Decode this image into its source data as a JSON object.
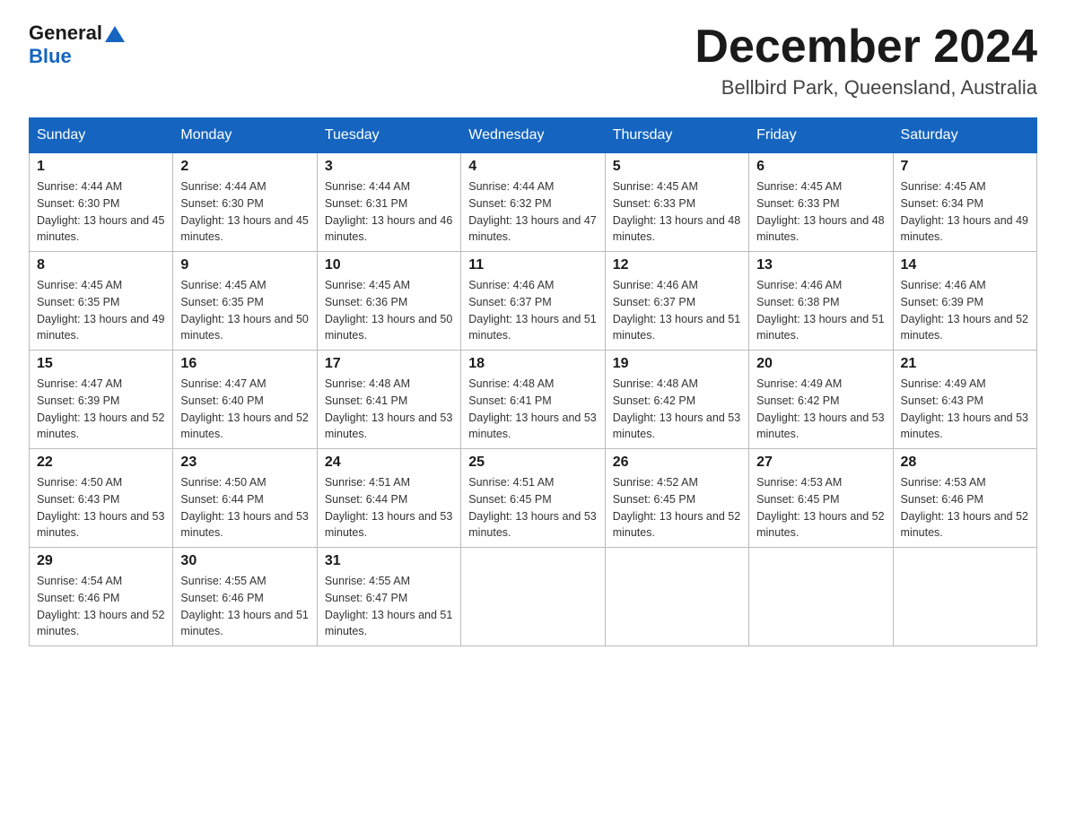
{
  "header": {
    "logo_general": "General",
    "logo_blue": "Blue",
    "month_title": "December 2024",
    "location": "Bellbird Park, Queensland, Australia"
  },
  "weekdays": [
    "Sunday",
    "Monday",
    "Tuesday",
    "Wednesday",
    "Thursday",
    "Friday",
    "Saturday"
  ],
  "weeks": [
    [
      {
        "day": "1",
        "sunrise": "4:44 AM",
        "sunset": "6:30 PM",
        "daylight": "13 hours and 45 minutes."
      },
      {
        "day": "2",
        "sunrise": "4:44 AM",
        "sunset": "6:30 PM",
        "daylight": "13 hours and 45 minutes."
      },
      {
        "day": "3",
        "sunrise": "4:44 AM",
        "sunset": "6:31 PM",
        "daylight": "13 hours and 46 minutes."
      },
      {
        "day": "4",
        "sunrise": "4:44 AM",
        "sunset": "6:32 PM",
        "daylight": "13 hours and 47 minutes."
      },
      {
        "day": "5",
        "sunrise": "4:45 AM",
        "sunset": "6:33 PM",
        "daylight": "13 hours and 48 minutes."
      },
      {
        "day": "6",
        "sunrise": "4:45 AM",
        "sunset": "6:33 PM",
        "daylight": "13 hours and 48 minutes."
      },
      {
        "day": "7",
        "sunrise": "4:45 AM",
        "sunset": "6:34 PM",
        "daylight": "13 hours and 49 minutes."
      }
    ],
    [
      {
        "day": "8",
        "sunrise": "4:45 AM",
        "sunset": "6:35 PM",
        "daylight": "13 hours and 49 minutes."
      },
      {
        "day": "9",
        "sunrise": "4:45 AM",
        "sunset": "6:35 PM",
        "daylight": "13 hours and 50 minutes."
      },
      {
        "day": "10",
        "sunrise": "4:45 AM",
        "sunset": "6:36 PM",
        "daylight": "13 hours and 50 minutes."
      },
      {
        "day": "11",
        "sunrise": "4:46 AM",
        "sunset": "6:37 PM",
        "daylight": "13 hours and 51 minutes."
      },
      {
        "day": "12",
        "sunrise": "4:46 AM",
        "sunset": "6:37 PM",
        "daylight": "13 hours and 51 minutes."
      },
      {
        "day": "13",
        "sunrise": "4:46 AM",
        "sunset": "6:38 PM",
        "daylight": "13 hours and 51 minutes."
      },
      {
        "day": "14",
        "sunrise": "4:46 AM",
        "sunset": "6:39 PM",
        "daylight": "13 hours and 52 minutes."
      }
    ],
    [
      {
        "day": "15",
        "sunrise": "4:47 AM",
        "sunset": "6:39 PM",
        "daylight": "13 hours and 52 minutes."
      },
      {
        "day": "16",
        "sunrise": "4:47 AM",
        "sunset": "6:40 PM",
        "daylight": "13 hours and 52 minutes."
      },
      {
        "day": "17",
        "sunrise": "4:48 AM",
        "sunset": "6:41 PM",
        "daylight": "13 hours and 53 minutes."
      },
      {
        "day": "18",
        "sunrise": "4:48 AM",
        "sunset": "6:41 PM",
        "daylight": "13 hours and 53 minutes."
      },
      {
        "day": "19",
        "sunrise": "4:48 AM",
        "sunset": "6:42 PM",
        "daylight": "13 hours and 53 minutes."
      },
      {
        "day": "20",
        "sunrise": "4:49 AM",
        "sunset": "6:42 PM",
        "daylight": "13 hours and 53 minutes."
      },
      {
        "day": "21",
        "sunrise": "4:49 AM",
        "sunset": "6:43 PM",
        "daylight": "13 hours and 53 minutes."
      }
    ],
    [
      {
        "day": "22",
        "sunrise": "4:50 AM",
        "sunset": "6:43 PM",
        "daylight": "13 hours and 53 minutes."
      },
      {
        "day": "23",
        "sunrise": "4:50 AM",
        "sunset": "6:44 PM",
        "daylight": "13 hours and 53 minutes."
      },
      {
        "day": "24",
        "sunrise": "4:51 AM",
        "sunset": "6:44 PM",
        "daylight": "13 hours and 53 minutes."
      },
      {
        "day": "25",
        "sunrise": "4:51 AM",
        "sunset": "6:45 PM",
        "daylight": "13 hours and 53 minutes."
      },
      {
        "day": "26",
        "sunrise": "4:52 AM",
        "sunset": "6:45 PM",
        "daylight": "13 hours and 52 minutes."
      },
      {
        "day": "27",
        "sunrise": "4:53 AM",
        "sunset": "6:45 PM",
        "daylight": "13 hours and 52 minutes."
      },
      {
        "day": "28",
        "sunrise": "4:53 AM",
        "sunset": "6:46 PM",
        "daylight": "13 hours and 52 minutes."
      }
    ],
    [
      {
        "day": "29",
        "sunrise": "4:54 AM",
        "sunset": "6:46 PM",
        "daylight": "13 hours and 52 minutes."
      },
      {
        "day": "30",
        "sunrise": "4:55 AM",
        "sunset": "6:46 PM",
        "daylight": "13 hours and 51 minutes."
      },
      {
        "day": "31",
        "sunrise": "4:55 AM",
        "sunset": "6:47 PM",
        "daylight": "13 hours and 51 minutes."
      },
      null,
      null,
      null,
      null
    ]
  ]
}
